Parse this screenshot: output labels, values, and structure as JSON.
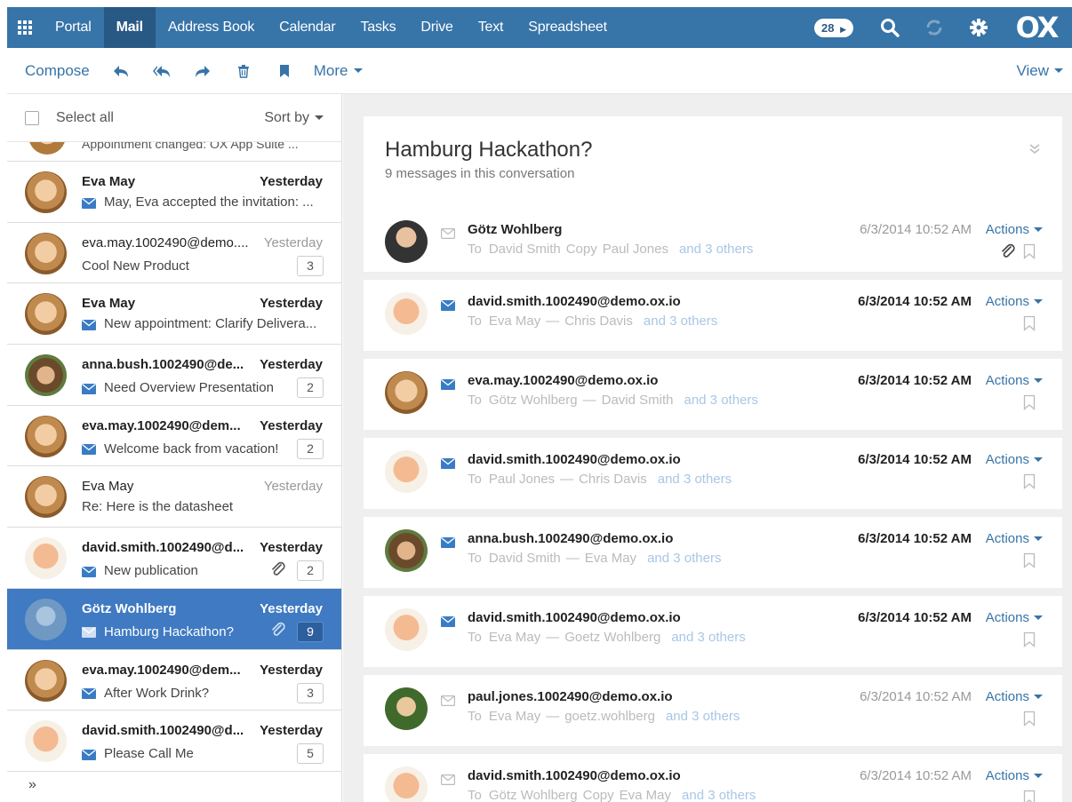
{
  "nav": {
    "items": [
      "Portal",
      "Mail",
      "Address Book",
      "Calendar",
      "Tasks",
      "Drive",
      "Text",
      "Spreadsheet"
    ],
    "active": "Mail",
    "badge_count": "28",
    "logo": "OX",
    "brand_color": "#3774a8"
  },
  "toolbar": {
    "compose": "Compose",
    "more": "More",
    "view": "View",
    "icons": [
      "reply-icon",
      "reply-all-icon",
      "forward-icon",
      "trash-icon",
      "bookmark-icon"
    ]
  },
  "list": {
    "select_all": "Select all",
    "sort_by": "Sort by",
    "partial_subject": "Appointment changed: OX App Suite ...",
    "expand_label": "»",
    "items": [
      {
        "sender": "Eva May",
        "date": "Yesterday",
        "subject": "May, Eva accepted the invitation: ...",
        "count": "",
        "unread": true,
        "envelope": true,
        "attachment": false,
        "avatar": "eva"
      },
      {
        "sender": "eva.may.1002490@demo....",
        "date": "Yesterday",
        "subject": "Cool New Product",
        "count": "3",
        "unread": false,
        "envelope": false,
        "attachment": false,
        "avatar": "eva"
      },
      {
        "sender": "Eva May",
        "date": "Yesterday",
        "subject": "New appointment: Clarify Delivera...",
        "count": "",
        "unread": true,
        "envelope": true,
        "attachment": false,
        "avatar": "eva"
      },
      {
        "sender": "anna.bush.1002490@de...",
        "date": "Yesterday",
        "subject": "Need Overview Presentation",
        "count": "2",
        "unread": true,
        "envelope": true,
        "attachment": false,
        "avatar": "anna"
      },
      {
        "sender": "eva.may.1002490@dem...",
        "date": "Yesterday",
        "subject": "Welcome back from vacation!",
        "count": "2",
        "unread": true,
        "envelope": true,
        "attachment": false,
        "avatar": "eva"
      },
      {
        "sender": "Eva May",
        "date": "Yesterday",
        "subject": "Re: Here is the datasheet",
        "count": "",
        "unread": false,
        "envelope": false,
        "attachment": false,
        "avatar": "eva"
      },
      {
        "sender": "david.smith.1002490@d...",
        "date": "Yesterday",
        "subject": "New publication",
        "count": "2",
        "unread": true,
        "envelope": true,
        "attachment": true,
        "avatar": "david"
      },
      {
        "sender": "Götz Wohlberg",
        "date": "Yesterday",
        "subject": "Hamburg Hackathon?",
        "count": "9",
        "unread": true,
        "envelope": true,
        "attachment": true,
        "avatar": "gotz",
        "selected": true
      },
      {
        "sender": "eva.may.1002490@dem...",
        "date": "Yesterday",
        "subject": "After Work Drink?",
        "count": "3",
        "unread": true,
        "envelope": true,
        "attachment": false,
        "avatar": "eva"
      },
      {
        "sender": "david.smith.1002490@d...",
        "date": "Yesterday",
        "subject": "Please Call Me",
        "count": "5",
        "unread": true,
        "envelope": true,
        "attachment": false,
        "avatar": "david"
      }
    ]
  },
  "detail": {
    "title": "Hamburg Hackathon?",
    "subtitle": "9 messages in this conversation",
    "actions_label": "Actions",
    "messages": [
      {
        "from": "Götz Wohlberg",
        "to_label": "To",
        "to": "David Smith",
        "joiner": "Copy",
        "cc": "Paul Jones",
        "more": "and 3 others",
        "date": "6/3/2014 10:52 AM",
        "unread": false,
        "attachment": true,
        "avatar": "gotz2"
      },
      {
        "from": "david.smith.1002490@demo.ox.io",
        "to_label": "To",
        "to": "Eva May",
        "joiner": "—",
        "cc": "Chris Davis",
        "more": "and 3 others",
        "date": "6/3/2014 10:52 AM",
        "unread": true,
        "attachment": false,
        "avatar": "david"
      },
      {
        "from": "eva.may.1002490@demo.ox.io",
        "to_label": "To",
        "to": "Götz Wohlberg",
        "joiner": "—",
        "cc": "David Smith",
        "more": "and 3 others",
        "date": "6/3/2014 10:52 AM",
        "unread": true,
        "attachment": false,
        "avatar": "eva"
      },
      {
        "from": "david.smith.1002490@demo.ox.io",
        "to_label": "To",
        "to": "Paul Jones",
        "joiner": "—",
        "cc": "Chris Davis",
        "more": "and 3 others",
        "date": "6/3/2014 10:52 AM",
        "unread": true,
        "attachment": false,
        "avatar": "david"
      },
      {
        "from": "anna.bush.1002490@demo.ox.io",
        "to_label": "To",
        "to": "David Smith",
        "joiner": "—",
        "cc": "Eva May",
        "more": "and 3 others",
        "date": "6/3/2014 10:52 AM",
        "unread": true,
        "attachment": false,
        "avatar": "anna"
      },
      {
        "from": "david.smith.1002490@demo.ox.io",
        "to_label": "To",
        "to": "Eva May",
        "joiner": "—",
        "cc": "Goetz Wohlberg",
        "more": "and 3 others",
        "date": "6/3/2014 10:52 AM",
        "unread": true,
        "attachment": false,
        "avatar": "david"
      },
      {
        "from": "paul.jones.1002490@demo.ox.io",
        "to_label": "To",
        "to": "Eva May",
        "joiner": "—",
        "cc": "goetz.wohlberg",
        "more": "and 3 others",
        "date": "6/3/2014 10:52 AM",
        "unread": false,
        "attachment": false,
        "avatar": "paul"
      },
      {
        "from": "david.smith.1002490@demo.ox.io",
        "to_label": "To",
        "to": "Götz Wohlberg",
        "joiner": "Copy",
        "cc": "Eva May",
        "more": "and 3 others",
        "date": "6/3/2014 10:52 AM",
        "unread": false,
        "attachment": false,
        "avatar": "david"
      }
    ]
  }
}
